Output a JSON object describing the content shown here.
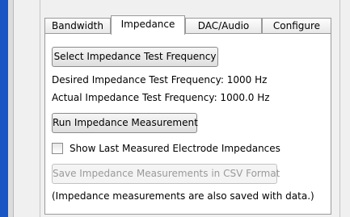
{
  "tabs": [
    "Bandwidth",
    "Impedance",
    "DAC/Audio",
    "Configure"
  ],
  "active_tab": "Impedance",
  "impedance": {
    "select_freq_button": "Select Impedance Test Frequency",
    "desired_freq_text": "Desired Impedance Test Frequency: 1000 Hz",
    "actual_freq_text": "Actual Impedance Test Frequency: 1000.0 Hz",
    "run_button": "Run Impedance Measurement",
    "show_last_checkbox_label": "Show Last Measured Electrode Impedances",
    "show_last_checked": false,
    "save_csv_button": "Save Impedance Measurements in CSV Format",
    "save_csv_enabled": false,
    "note_text": "(Impedance measurements are also saved with data.)"
  },
  "colors": {
    "sidebar_accent": "#1a55c4",
    "panel_background": "#ffffff",
    "window_background": "#f0f0f0"
  }
}
